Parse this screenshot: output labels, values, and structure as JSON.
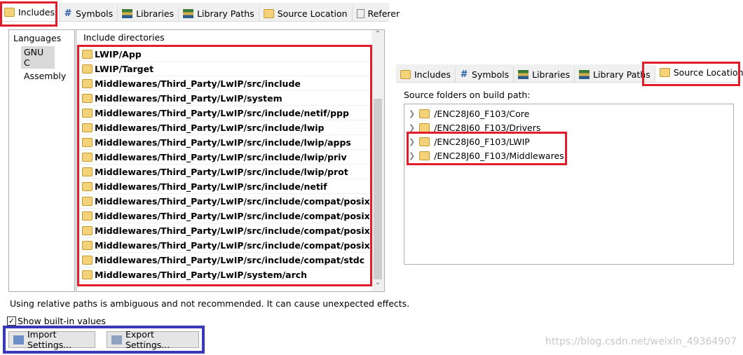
{
  "left": {
    "tabs": [
      {
        "label": "Includes",
        "icon": "includes-icon",
        "active": true
      },
      {
        "label": "Symbols",
        "icon": "hash-icon"
      },
      {
        "label": "Libraries",
        "icon": "libraries-icon"
      },
      {
        "label": "Library Paths",
        "icon": "library-paths-icon"
      },
      {
        "label": "Source Location",
        "icon": "source-location-icon"
      },
      {
        "label": "Referer",
        "icon": "references-icon"
      }
    ],
    "languages_header": "Languages",
    "languages": [
      "GNU C",
      "Assembly"
    ],
    "selected_language": "GNU C",
    "include_header": "Include directories",
    "includes": [
      "LWIP/App",
      "LWIP/Target",
      "Middlewares/Third_Party/LwIP/src/include",
      "Middlewares/Third_Party/LwIP/system",
      "Middlewares/Third_Party/LwIP/src/include/netif/ppp",
      "Middlewares/Third_Party/LwIP/src/include/lwip",
      "Middlewares/Third_Party/LwIP/src/include/lwip/apps",
      "Middlewares/Third_Party/LwIP/src/include/lwip/priv",
      "Middlewares/Third_Party/LwIP/src/include/lwip/prot",
      "Middlewares/Third_Party/LwIP/src/include/netif",
      "Middlewares/Third_Party/LwIP/src/include/compat/posix",
      "Middlewares/Third_Party/LwIP/src/include/compat/posix/arpa",
      "Middlewares/Third_Party/LwIP/src/include/compat/posix/net",
      "Middlewares/Third_Party/LwIP/src/include/compat/posix/sys",
      "Middlewares/Third_Party/LwIP/src/include/compat/stdc",
      "Middlewares/Third_Party/LwIP/system/arch"
    ],
    "warning": "Using relative paths is ambiguous and not recommended. It can cause unexpected effects.",
    "show_builtin_label": "Show built-in values",
    "show_builtin_checked": true,
    "import_label": "Import Settings...",
    "export_label": "Export Settings..."
  },
  "right": {
    "tabs": [
      {
        "label": "Includes"
      },
      {
        "label": "Symbols"
      },
      {
        "label": "Libraries"
      },
      {
        "label": "Library Paths"
      },
      {
        "label": "Source Location",
        "active": true
      }
    ],
    "folders_label": "Source folders on build path:",
    "folders": [
      "/ENC28J60_F103/Core",
      "/ENC28J60_F103/Drivers",
      "/ENC28J60_F103/LWIP",
      "/ENC28J60_F103/Middlewares"
    ]
  },
  "watermark": "https://blog.csdn.net/weixin_49364907",
  "colors": {
    "highlight_red": "#e01e2a",
    "highlight_blue": "#3a3ab8"
  }
}
